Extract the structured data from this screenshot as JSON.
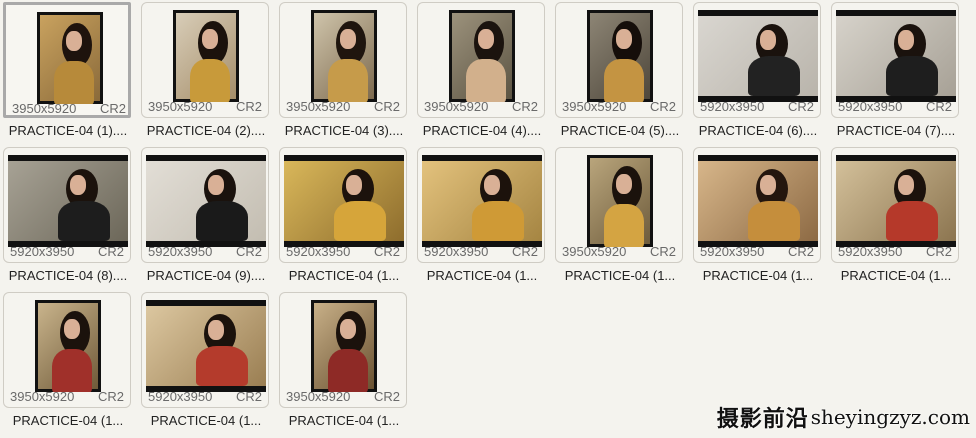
{
  "items": [
    {
      "name": "PRACTICE-04 (1)....",
      "dims": "3950x5920",
      "ext": "CR2",
      "orientation": "portrait",
      "selected": true,
      "bg": "#c9a25f",
      "bg2": "#8a6a3a",
      "hair": "#1e130d",
      "cloth": "#b78a3a"
    },
    {
      "name": "PRACTICE-04 (2)....",
      "dims": "3950x5920",
      "ext": "CR2",
      "orientation": "portrait",
      "selected": false,
      "bg": "#d8cdb8",
      "bg2": "#a58e6a",
      "hair": "#1b120c",
      "cloth": "#c89a3a"
    },
    {
      "name": "PRACTICE-04 (3)....",
      "dims": "3950x5920",
      "ext": "CR2",
      "orientation": "portrait",
      "selected": false,
      "bg": "#cfc4ab",
      "bg2": "#7d6a4e",
      "hair": "#1f150e",
      "cloth": "#c69b4a"
    },
    {
      "name": "PRACTICE-04 (4)....",
      "dims": "3950x5920",
      "ext": "CR2",
      "orientation": "portrait",
      "selected": false,
      "bg": "#9c927c",
      "bg2": "#5c5443",
      "hair": "#1b130e",
      "cloth": "#d2b08c"
    },
    {
      "name": "PRACTICE-04 (5)....",
      "dims": "3950x5920",
      "ext": "CR2",
      "orientation": "portrait",
      "selected": false,
      "bg": "#8d8575",
      "bg2": "#4e473b",
      "hair": "#150e0a",
      "cloth": "#c49442"
    },
    {
      "name": "PRACTICE-04 (6)....",
      "dims": "5920x3950",
      "ext": "CR2",
      "orientation": "landscape",
      "selected": false,
      "bg": "#d9d6d0",
      "bg2": "#b9b4ab",
      "hair": "#1a120d",
      "cloth": "#222222"
    },
    {
      "name": "PRACTICE-04 (7)....",
      "dims": "5920x3950",
      "ext": "CR2",
      "orientation": "landscape",
      "selected": false,
      "bg": "#d6d2ca",
      "bg2": "#a7a196",
      "hair": "#1a120d",
      "cloth": "#1e1e1e"
    },
    {
      "name": "PRACTICE-04 (8)....",
      "dims": "5920x3950",
      "ext": "CR2",
      "orientation": "landscape",
      "selected": false,
      "bg": "#a7a295",
      "bg2": "#6c6759",
      "hair": "#1b120c",
      "cloth": "#1d1d1d"
    },
    {
      "name": "PRACTICE-04 (9)....",
      "dims": "5920x3950",
      "ext": "CR2",
      "orientation": "landscape",
      "selected": false,
      "bg": "#e2ded6",
      "bg2": "#c3bdb1",
      "hair": "#1a120d",
      "cloth": "#1a1a1a"
    },
    {
      "name": "PRACTICE-04 (1...",
      "dims": "5920x3950",
      "ext": "CR2",
      "orientation": "landscape",
      "selected": false,
      "bg": "#d9b75a",
      "bg2": "#8e6d2d",
      "hair": "#1c120c",
      "cloth": "#d6a53a"
    },
    {
      "name": "PRACTICE-04 (1...",
      "dims": "5920x3950",
      "ext": "CR2",
      "orientation": "landscape",
      "selected": false,
      "bg": "#e3c27d",
      "bg2": "#a58542",
      "hair": "#1c120c",
      "cloth": "#cf9a36"
    },
    {
      "name": "PRACTICE-04 (1...",
      "dims": "3950x5920",
      "ext": "CR2",
      "orientation": "portrait",
      "selected": false,
      "bg": "#b9a57c",
      "bg2": "#6e5c3c",
      "hair": "#1b120c",
      "cloth": "#d4a442"
    },
    {
      "name": "PRACTICE-04 (1...",
      "dims": "5920x3950",
      "ext": "CR2",
      "orientation": "landscape",
      "selected": false,
      "bg": "#d7b68a",
      "bg2": "#8d6a44",
      "hair": "#24160e",
      "cloth": "#c58e3c"
    },
    {
      "name": "PRACTICE-04 (1...",
      "dims": "5920x3950",
      "ext": "CR2",
      "orientation": "landscape",
      "selected": false,
      "bg": "#d3c09a",
      "bg2": "#8c7550",
      "hair": "#1c120c",
      "cloth": "#b5392a"
    },
    {
      "name": "PRACTICE-04 (1...",
      "dims": "3950x5920",
      "ext": "CR2",
      "orientation": "portrait",
      "selected": false,
      "bg": "#c9b48c",
      "bg2": "#6f5a39",
      "hair": "#1b120c",
      "cloth": "#a0302a"
    },
    {
      "name": "PRACTICE-04 (1...",
      "dims": "5920x3950",
      "ext": "CR2",
      "orientation": "landscape",
      "selected": false,
      "bg": "#dcc7a0",
      "bg2": "#9a7e52",
      "hair": "#1b120c",
      "cloth": "#b43b2c"
    },
    {
      "name": "PRACTICE-04 (1...",
      "dims": "3950x5920",
      "ext": "CR2",
      "orientation": "portrait",
      "selected": false,
      "bg": "#c8b088",
      "bg2": "#6a5232",
      "hair": "#1b120c",
      "cloth": "#8e2a26"
    }
  ],
  "watermark": {
    "cn": "摄影前沿",
    "url": "sheyingzyz.com"
  }
}
